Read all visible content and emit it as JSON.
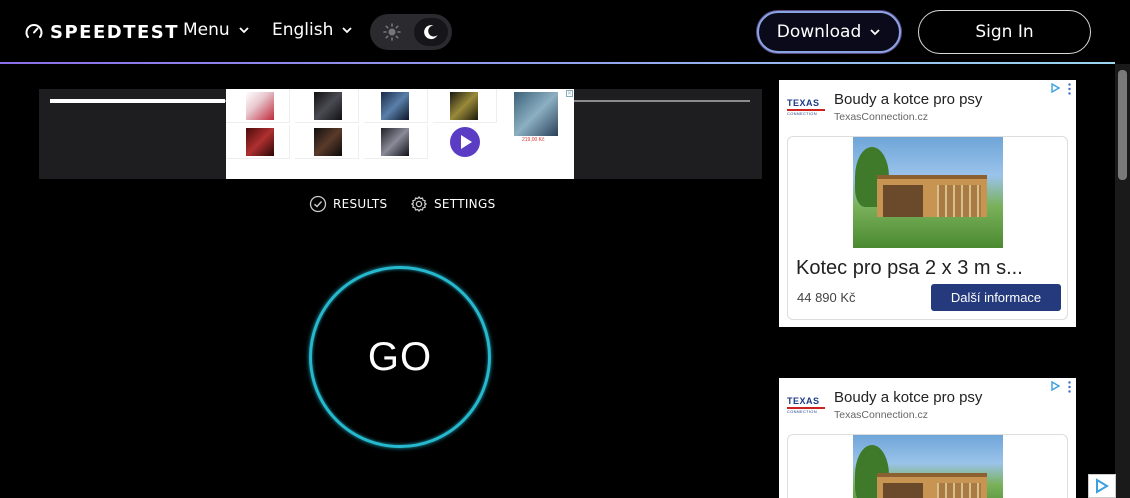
{
  "header": {
    "logo_text": "SPEEDTEST",
    "menu_label": "Menu",
    "language_label": "English",
    "download_label": "Download",
    "signin_label": "Sign In"
  },
  "colors": {
    "accent_cyan": "#26b8cc",
    "gradient_start": "#8b6ee8",
    "gradient_end": "#9ad6f0",
    "ad_cta": "#243a7c"
  },
  "top_ad": {
    "price": "219,00 Kč",
    "progress_fraction": 0.25
  },
  "subnav": {
    "results_label": "RESULTS",
    "settings_label": "SETTINGS"
  },
  "go": {
    "label": "GO"
  },
  "side_ads": [
    {
      "brand_line1": "TEXAS",
      "brand_line2": "CONNECTION",
      "title": "Boudy a kotce pro psy",
      "domain": "TexasConnection.cz",
      "headline": "Kotec pro psa 2 x 3 m s...",
      "price": "44 890 Kč",
      "cta": "Další informace"
    },
    {
      "brand_line1": "TEXAS",
      "brand_line2": "CONNECTION",
      "title": "Boudy a kotce pro psy",
      "domain": "TexasConnection.cz"
    }
  ],
  "icons": [
    "speedometer-icon",
    "chevron-down-icon",
    "sun-icon",
    "moon-icon",
    "checkmark-circle-icon",
    "gear-icon",
    "adchoices-icon",
    "kebab-icon",
    "play-icon"
  ]
}
